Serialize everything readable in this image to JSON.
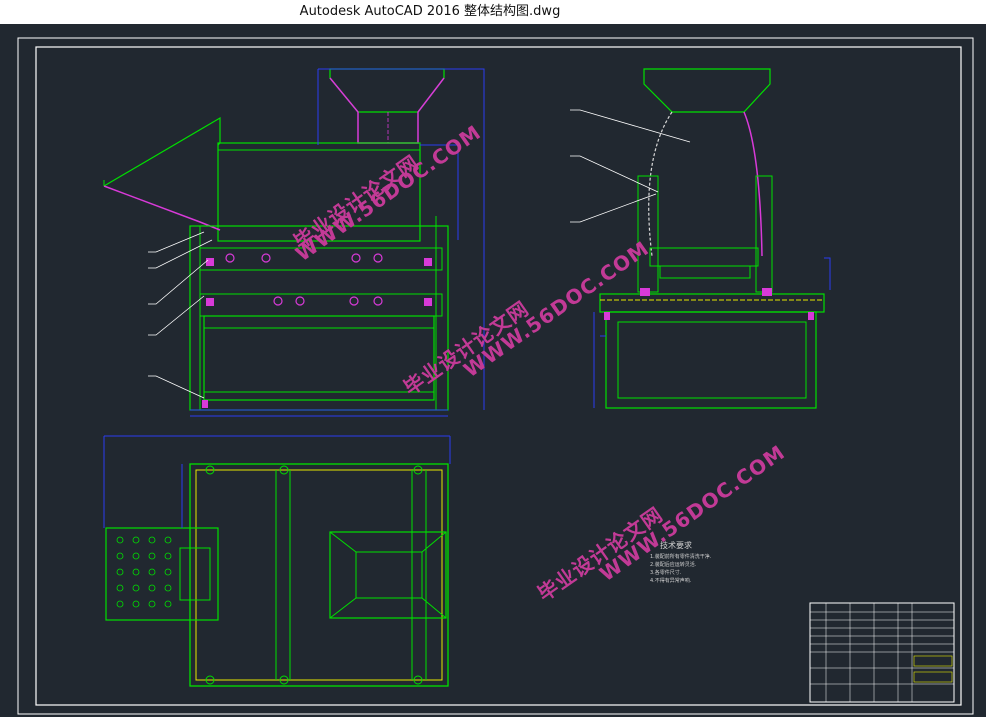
{
  "window": {
    "title": "Autodesk AutoCAD 2016     整体结构图.dwg"
  },
  "watermarks": [
    "毕业设计论文网",
    "WWW.56DOC.COM"
  ],
  "tech_notes": {
    "heading": "技术要求",
    "lines": [
      "1.装配前所有零件清洗干净.",
      "2.装配后应运转灵活.",
      "3.各零件尺寸.",
      "4.不得有异常声响."
    ]
  },
  "colors": {
    "background": "#212830",
    "frame": "#ffffff",
    "geometry": "#00e000",
    "dimension": "#2a3df0",
    "highlight": "#d83ad8",
    "yellow": "#e8e800"
  }
}
